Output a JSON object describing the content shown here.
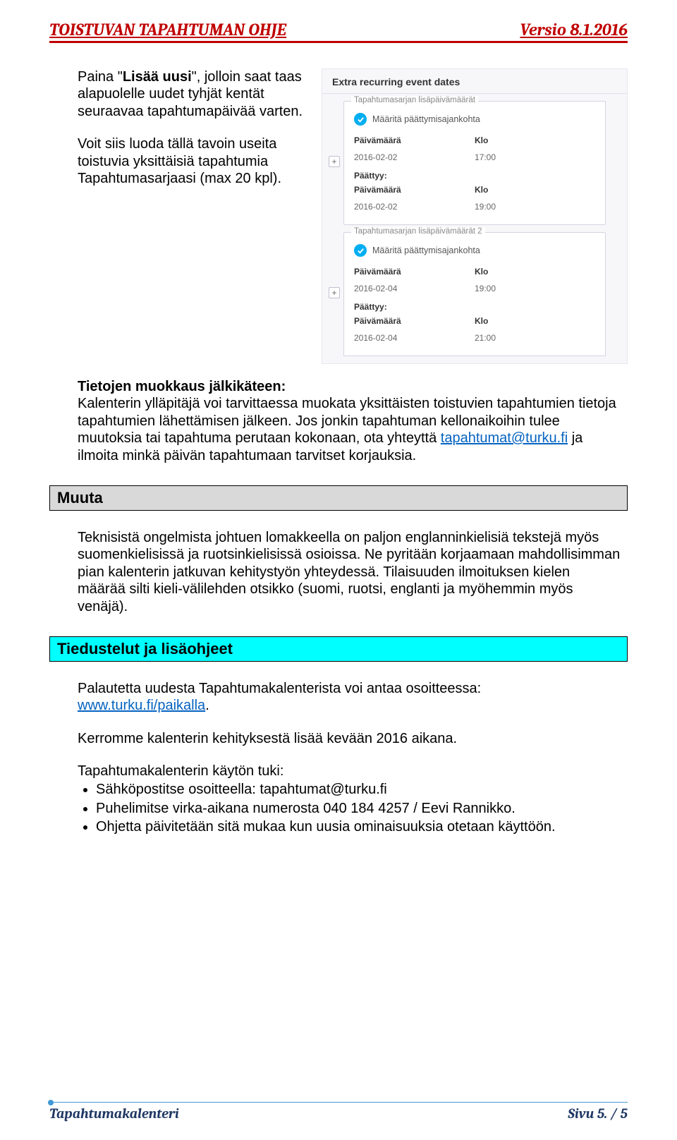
{
  "header": {
    "title_left": "TOISTUVAN TAPAHTUMAN OHJE",
    "title_right": "Versio 8.1.2016"
  },
  "intro": {
    "p1a": "Paina \"",
    "p1b": "Lisää uusi",
    "p1c": "\", jolloin saat taas alapuolelle uudet tyhjät kentät seuraavaa tapahtumapäivää varten.",
    "p2": "Voit siis luoda tällä tavoin useita toistuvia yksittäisiä tapahtumia Tapahtumasarjaasi (max 20 kpl)."
  },
  "panel": {
    "title": "Extra recurring event dates",
    "groups": [
      {
        "legend": "Tapahtumasarjan lisäpäivämäärät",
        "chk": "Määritä päättymisajankohta",
        "colA": "Päivämäärä",
        "colB": "Klo",
        "val1a": "2016-02-02",
        "val1b": "17:00",
        "endlabel": "Päättyy:",
        "val2a": "2016-02-02",
        "val2b": "19:00",
        "expand": "+"
      },
      {
        "legend": "Tapahtumasarjan lisäpäivämäärät 2",
        "chk": "Määritä päättymisajankohta",
        "colA": "Päivämäärä",
        "colB": "Klo",
        "val1a": "2016-02-04",
        "val1b": "19:00",
        "endlabel": "Päättyy:",
        "val2a": "2016-02-04",
        "val2b": "21:00",
        "expand": "+"
      }
    ]
  },
  "edit": {
    "heading": "Tietojen muokkaus jälkikäteen:",
    "p_a": "Kalenterin ylläpitäjä voi tarvittaessa muokata yksittäisten toistuvien tapahtumien tietoja tapahtumien lähettämisen jälkeen. Jos jonkin tapahtuman kellonaikoihin tulee muutoksia tai tapahtuma perutaan kokonaan, ota yhteyttä ",
    "link": "tapahtumat@turku.fi",
    "p_b": " ja ilmoita minkä päivän tapahtumaan tarvitset korjauksia."
  },
  "muuta": {
    "heading": "Muuta",
    "p": "Teknisistä ongelmista johtuen lomakkeella on paljon englanninkielisiä tekstejä myös suomenkielisissä ja ruotsinkielisissä osioissa. Ne pyritään korjaamaan mahdollisimman pian kalenterin jatkuvan kehitystyön yhteydessä. Tilaisuuden ilmoituksen kielen määrää silti kieli-välilehden otsikko (suomi, ruotsi, englanti ja myöhemmin myös venäjä)."
  },
  "tied": {
    "heading": "Tiedustelut ja lisäohjeet",
    "p1a": "Palautetta uudesta Tapahtumakalenterista voi antaa osoitteessa:",
    "link1": "www.turku.fi/paikalla",
    "p1b": ".",
    "p2": "Kerromme kalenterin kehityksestä lisää kevään 2016 aikana.",
    "p3": "Tapahtumakalenterin käytön tuki:",
    "b1": "Sähköpostitse osoitteella: tapahtumat@turku.fi",
    "b2": "Puhelimitse virka-aikana numerosta 040 184 4257 / Eevi Rannikko.",
    "b3": "Ohjetta päivitetään sitä mukaa kun uusia ominaisuuksia otetaan käyttöön."
  },
  "footer": {
    "left": "Tapahtumakalenteri",
    "right": "Sivu 5. / 5"
  }
}
